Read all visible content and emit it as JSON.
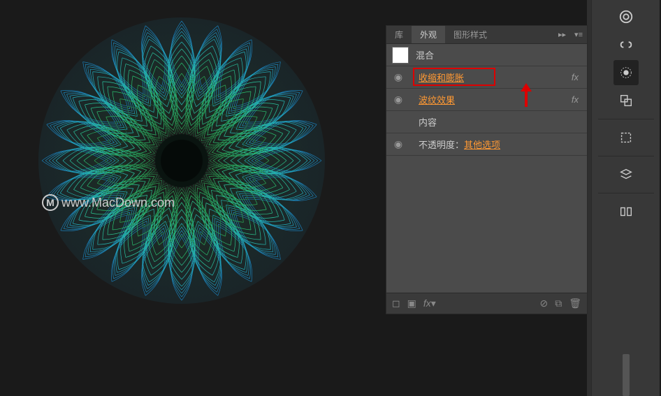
{
  "watermark": {
    "text": "www.MacDown.com",
    "icon_letter": "M"
  },
  "panel": {
    "tabs": [
      {
        "label": "库",
        "active": false
      },
      {
        "label": "外观",
        "active": true
      },
      {
        "label": "图形样式",
        "active": false
      }
    ],
    "header": {
      "label": "混合"
    },
    "rows": [
      {
        "type": "effect",
        "label": "收缩和膨胀",
        "fx": "fx",
        "highlighted": true
      },
      {
        "type": "effect",
        "label": "波纹效果",
        "fx": "fx",
        "highlighted": false
      },
      {
        "type": "content",
        "label": "内容"
      },
      {
        "type": "opacity",
        "prefix": "不透明度：",
        "value": "其他选项"
      }
    ],
    "footer_icons": [
      "no-stroke",
      "no-fill",
      "fx-menu",
      "clear",
      "duplicate",
      "delete"
    ]
  },
  "dock": {
    "buttons": [
      "creative-cloud",
      "texture",
      "appearance",
      "layers",
      "artboards",
      "spacer",
      "libraries"
    ]
  }
}
